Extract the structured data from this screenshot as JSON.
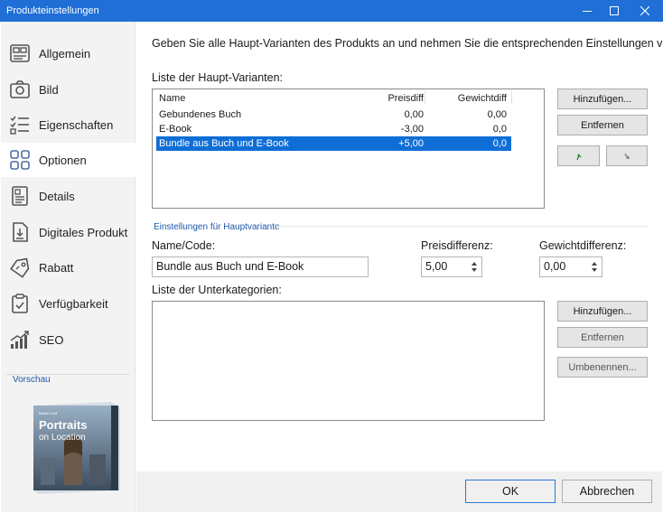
{
  "window": {
    "title": "Produkteinstellungen"
  },
  "sidebar": {
    "items": [
      {
        "label": "Allgemein",
        "icon": "layout-icon"
      },
      {
        "label": "Bild",
        "icon": "camera-icon"
      },
      {
        "label": "Eigenschaften",
        "icon": "checklist-icon"
      },
      {
        "label": "Optionen",
        "icon": "grid-icon",
        "active": true
      },
      {
        "label": "Details",
        "icon": "document-icon"
      },
      {
        "label": "Digitales Produkt",
        "icon": "download-file-icon"
      },
      {
        "label": "Rabatt",
        "icon": "tag-icon"
      },
      {
        "label": "Verfügbarkeit",
        "icon": "clipboard-check-icon"
      },
      {
        "label": "SEO",
        "icon": "bar-chart-icon"
      }
    ],
    "preview_label": "Vorschau",
    "preview_book": {
      "title_line1": "Portraits",
      "title_line2": "on Location"
    }
  },
  "main": {
    "intro": "Geben Sie alle Haupt-Varianten des Produkts an und nehmen Sie die entsprechenden Einstellungen vor.",
    "variants_label": "Liste der Haupt-Varianten:",
    "variants_table": {
      "headers": [
        "Name",
        "Preisdiff",
        "Gewichtdiff"
      ],
      "rows": [
        [
          "Gebundenes Buch",
          "0,00",
          "0,00"
        ],
        [
          "E-Book",
          "-3,00",
          "0,0"
        ],
        [
          "Bundle aus Buch und E-Book",
          "+5,00",
          "0,0"
        ]
      ],
      "selected_row": 2
    },
    "variant_buttons": {
      "add": "Hinzufügen...",
      "remove": "Entfernen",
      "move_up_icon": "arrow-up-icon",
      "move_down_icon": "arrow-down-icon"
    },
    "settings_section_title": "Einstellungen für Hauptvariante",
    "name_label": "Name/Code:",
    "name_value": "Bundle aus Buch und E-Book",
    "price_label": "Preisdifferenz:",
    "price_value": "5,00",
    "weight_label": "Gewichtdifferenz:",
    "weight_value": "0,00",
    "subcategories_label": "Liste der Unterkategorien:",
    "sub_buttons": {
      "add": "Hinzufügen...",
      "remove": "Entfernen",
      "rename": "Umbenennen..."
    }
  },
  "footer": {
    "ok": "OK",
    "cancel": "Abbrechen"
  },
  "colors": {
    "titlebar": "#1f6fd6",
    "selection": "#0f6ed6",
    "accent_text": "#1f57a8",
    "arrow_green": "#2a8a3a"
  }
}
